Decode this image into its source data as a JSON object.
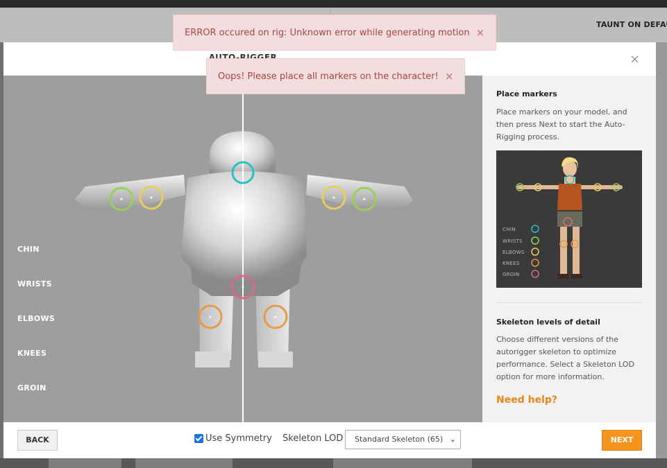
{
  "background": {
    "header_text": "TAUNT ON DEFAU"
  },
  "modal": {
    "title": "AUTO-RIGGER",
    "close": "×"
  },
  "toasts": [
    {
      "message": "ERROR occured on rig: Unknown error while generating motion",
      "close": "×"
    },
    {
      "message": "Oops! Please place all markers on the character!",
      "close": "×"
    }
  ],
  "markers": {
    "labels": [
      "CHIN",
      "WRISTS",
      "ELBOWS",
      "KNEES",
      "GROIN"
    ],
    "colors": {
      "chin": "#2bbfc4",
      "wrists": "#9ccf5a",
      "elbows": "#e7cd5e",
      "knees": "#e89a45",
      "groin": "#d86a86"
    }
  },
  "side_panel": {
    "place_title": "Place markers",
    "place_text": "Place markers on your model, and then press Next to start the Auto-Rigging process.",
    "ref_labels": [
      "CHIN",
      "WRISTS",
      "ELBOWS",
      "KNEES",
      "GROIN"
    ],
    "lod_title": "Skeleton levels of detail",
    "lod_text": "Choose different versions of the autorigger skeleton to optimize performance. Select a Skeleton LOD option for more information.",
    "help": "Need help?"
  },
  "footer": {
    "back": "BACK",
    "symmetry_label": "Use Symmetry",
    "symmetry_checked": true,
    "lod_label": "Skeleton LOD",
    "lod_value": "Standard Skeleton (65)",
    "next": "NEXT"
  },
  "accent_color": "#f7941d"
}
